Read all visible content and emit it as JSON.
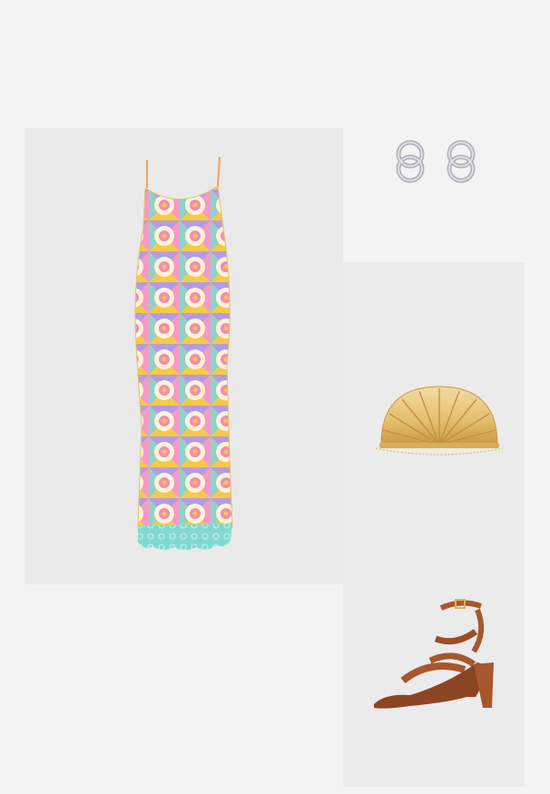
{
  "outfit": {
    "items": [
      {
        "name": "dress",
        "icon": "floral-slip-dress"
      },
      {
        "name": "earrings",
        "icon": "silver-double-hoop-earrings"
      },
      {
        "name": "clutch",
        "icon": "gold-shell-clutch"
      },
      {
        "name": "sandals",
        "icon": "brown-strappy-heel-sandal"
      }
    ]
  },
  "colors": {
    "page_background": "#f3f3f3",
    "dress_panel": "#e9e9e9",
    "right_panel": "#ebebeb",
    "dress_hem": "#7fd9d0",
    "gold": "#e3c27a",
    "leather": "#a8572d",
    "silver": "#b9bdc3"
  }
}
